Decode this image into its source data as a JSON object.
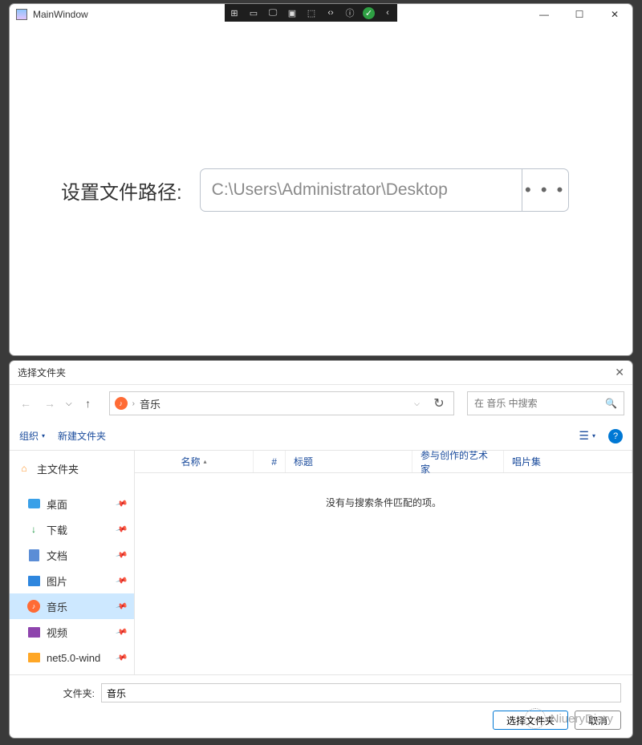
{
  "mainWindow": {
    "title": "MainWindow",
    "form": {
      "label": "设置文件路径:",
      "pathValue": "C:\\Users\\Administrator\\Desktop",
      "browseLabel": "• • •"
    },
    "controls": {
      "min": "—",
      "max": "☐",
      "close": "✕"
    }
  },
  "dialog": {
    "title": "选择文件夹",
    "close": "✕",
    "address": {
      "location": "音乐"
    },
    "search": {
      "placeholder": "在 音乐 中搜索"
    },
    "toolbar": {
      "organize": "组织",
      "newFolder": "新建文件夹",
      "viewIcon": "☰"
    },
    "sidebar": {
      "home": "主文件夹",
      "items": [
        {
          "label": "桌面",
          "pinned": true
        },
        {
          "label": "下载",
          "pinned": true
        },
        {
          "label": "文档",
          "pinned": true
        },
        {
          "label": "图片",
          "pinned": true
        },
        {
          "label": "音乐",
          "pinned": true,
          "selected": true
        },
        {
          "label": "视频",
          "pinned": true
        },
        {
          "label": "net5.0-wind",
          "pinned": true
        }
      ]
    },
    "columns": {
      "name": "名称",
      "num": "#",
      "title": "标题",
      "artist": "参与创作的艺术家",
      "album": "唱片集"
    },
    "emptyMsg": "没有与搜索条件匹配的项。",
    "footer": {
      "folderLabel": "文件夹:",
      "folderValue": "音乐",
      "selectBtn": "选择文件夹",
      "cancelBtn": "取消"
    }
  },
  "watermark": "NiueryDiary"
}
